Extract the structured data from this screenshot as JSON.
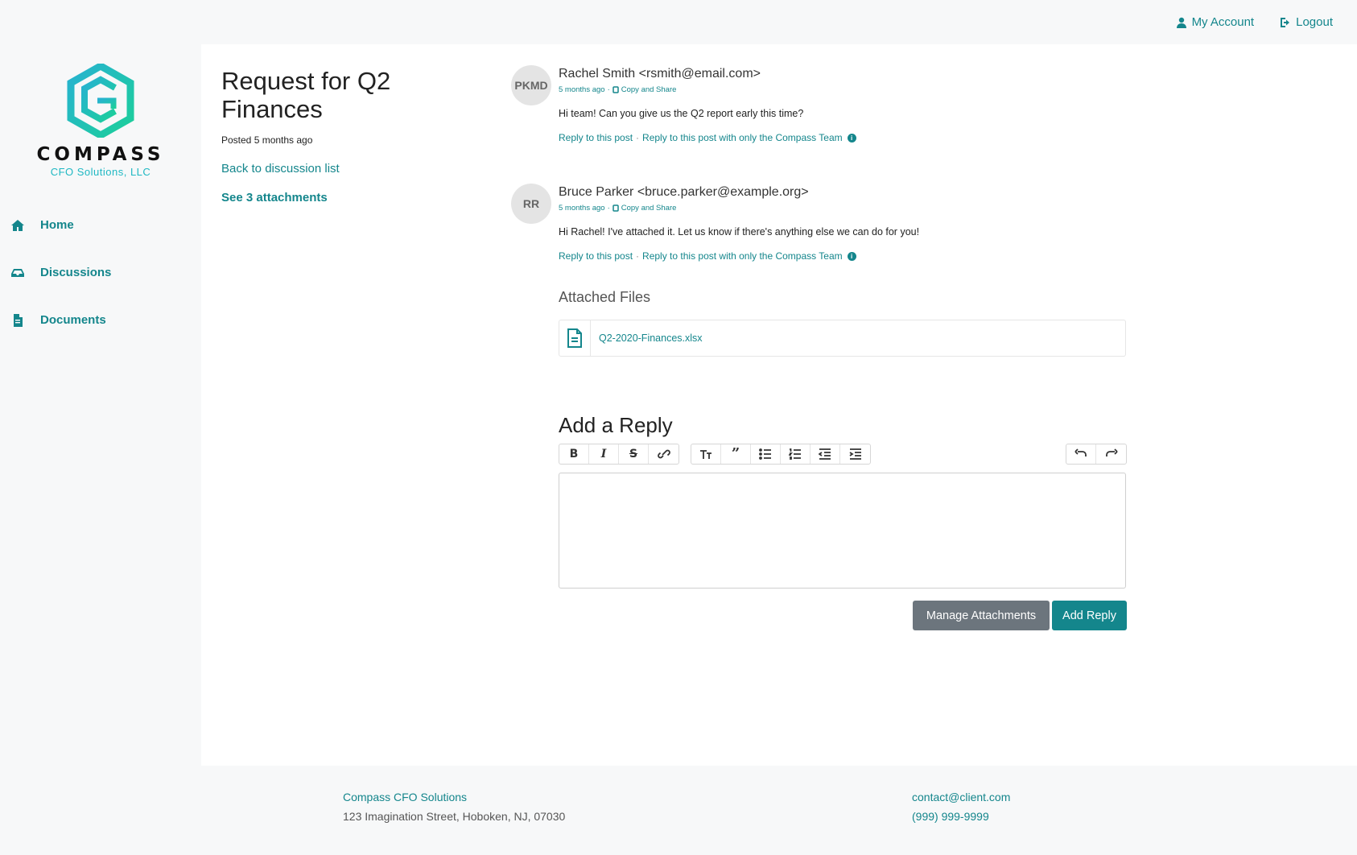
{
  "topnav": {
    "account": "My Account",
    "logout": "Logout"
  },
  "logo": {
    "word": "COMPASS",
    "sub": "CFO Solutions, LLC"
  },
  "sidebar": {
    "items": [
      {
        "label": "Home"
      },
      {
        "label": "Discussions"
      },
      {
        "label": "Documents"
      }
    ]
  },
  "discussion": {
    "title": "Request for Q2 Finances",
    "posted": "Posted 5 months ago",
    "back_link": "Back to discussion list",
    "attachments_link": "See 3 attachments"
  },
  "posts": [
    {
      "avatar": "PKMD",
      "author": "Rachel Smith <rsmith@email.com>",
      "time": "5 months ago",
      "copy": "Copy and Share",
      "message": "Hi team! Can you give us the Q2 report early this time?",
      "reply": "Reply to this post",
      "reply_team": "Reply to this post with only the Compass Team"
    },
    {
      "avatar": "RR",
      "author": "Bruce Parker <bruce.parker@example.org>",
      "time": "5 months ago",
      "copy": "Copy and Share",
      "message": "Hi Rachel! I've attached it. Let us know if there's anything else we can do for you!",
      "reply": "Reply to this post",
      "reply_team": "Reply to this post with only the Compass Team"
    }
  ],
  "attached": {
    "title": "Attached Files",
    "file": "Q2-2020-Finances.xlsx"
  },
  "reply_form": {
    "title": "Add a Reply",
    "manage": "Manage Attachments",
    "submit": "Add Reply"
  },
  "footer": {
    "company": "Compass CFO Solutions",
    "address": "123 Imagination Street, Hoboken, NJ, 07030",
    "email": "contact@client.com",
    "phone": "(999) 999-9999"
  },
  "colors": {
    "accent": "#14868c",
    "secondary": "#6c757d"
  }
}
